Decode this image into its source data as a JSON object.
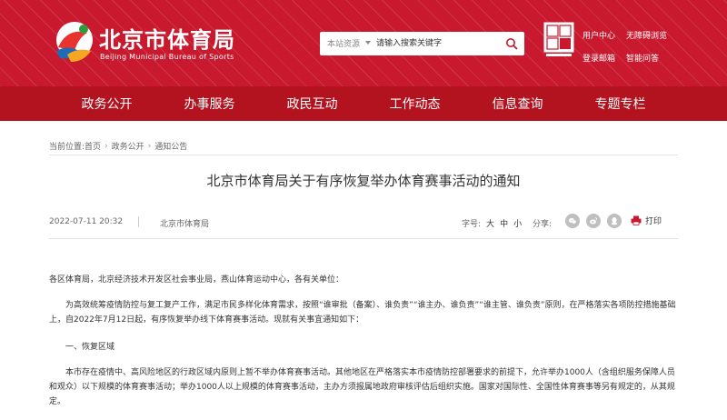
{
  "header": {
    "title_cn": "北京市体育局",
    "title_en": "Beijing Municipal Bureau of Sports",
    "search": {
      "scope": "本站资源",
      "placeholder": "请输入搜索关键字"
    },
    "top_links": [
      "用户中心",
      "无障碍浏览",
      "登录邮箱",
      "智能问答"
    ]
  },
  "nav": {
    "items": [
      "政务公开",
      "办事服务",
      "政民互动",
      "工作动态",
      "信息查询",
      "专题专栏"
    ]
  },
  "breadcrumb": {
    "items": [
      "当前位置:首页",
      "政务公开",
      "通知公告"
    ]
  },
  "article": {
    "title": "北京市体育局关于有序恢复举办体育赛事活动的通知",
    "date": "2022-07-11 20:32",
    "source": "北京市体育局",
    "font_size_label": "字号:",
    "font_sizes": [
      "大",
      "中",
      "小"
    ],
    "share_label": "分享:",
    "print_label": "打印",
    "paragraphs": {
      "salutation": "各区体育局，北京经济技术开发区社会事业局，燕山体育运动中心，各有关单位：",
      "intro": "为高效统筹疫情防控与复工复产工作，满足市民多样化体育需求，按照“谁审批（备案）、谁负责”“谁主办、谁负责”“谁主管、谁负责”原则，在严格落实各项防控措施基础上，自2022年7月12日起，有序恢复举办线下体育赛事活动。现就有关事宜通知如下：",
      "heading1": "一、恢复区域",
      "section1": "本市存在疫情中、高风险地区的行政区域内原则上暂不举办体育赛事活动。其他地区在严格落实本市疫情防控部署要求的前提下，允许举办1000人（含组织服务保障人员和观众）以下规模的体育赛事活动；举办1000人以上规模的体育赛事活动，主办方须报属地政府审核评估后组织实施。国家对国际性、全国性体育赛事等另有规定的，从其规定。"
    }
  },
  "colors": {
    "header_red": "#c8192e",
    "nav_red": "#b3121f"
  }
}
